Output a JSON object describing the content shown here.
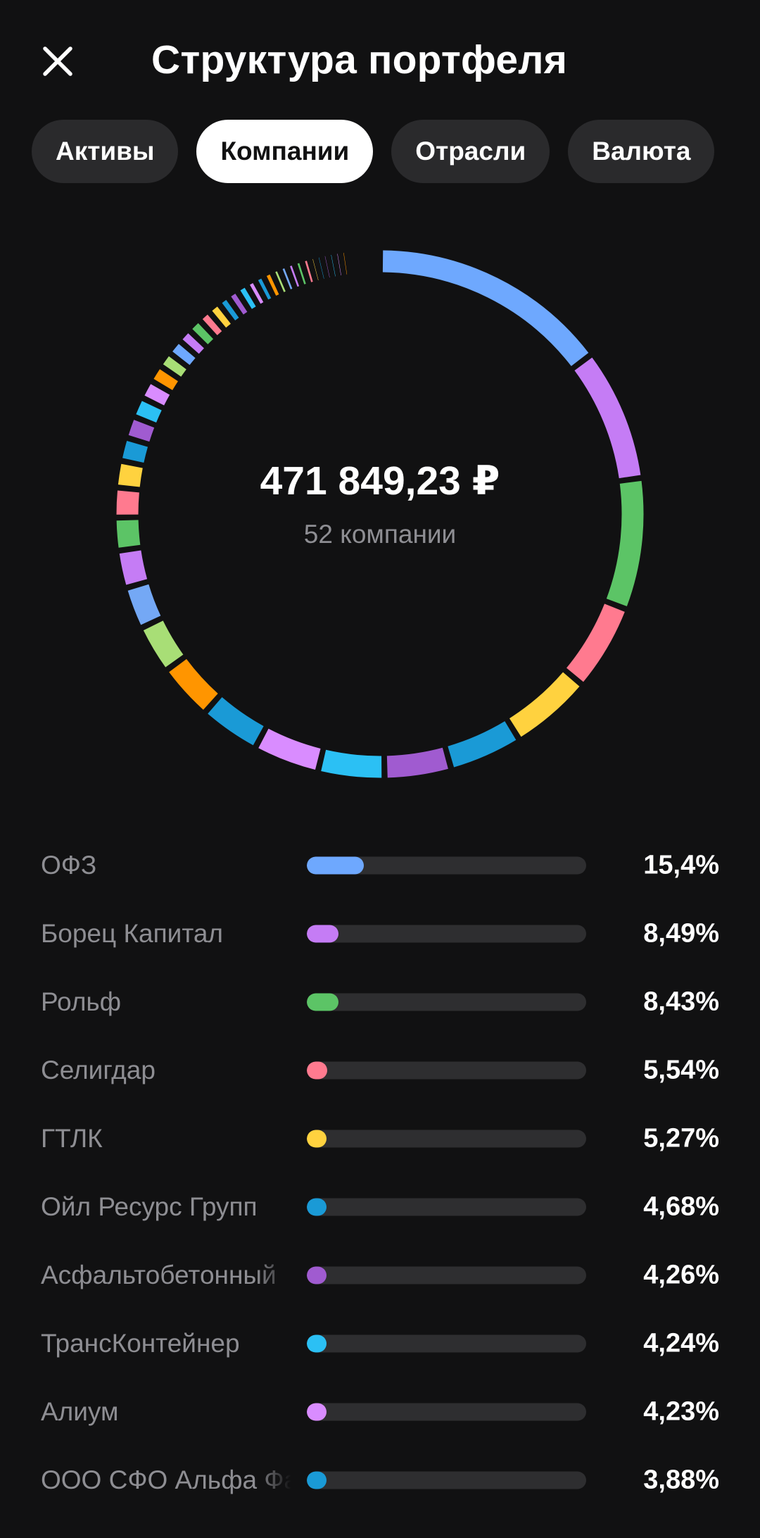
{
  "header": {
    "title": "Структура портфеля",
    "close_icon": "close-icon"
  },
  "tabs": [
    {
      "label": "Активы",
      "active": false
    },
    {
      "label": "Компании",
      "active": true
    },
    {
      "label": "Отрасли",
      "active": false
    },
    {
      "label": "Валюта",
      "active": false
    }
  ],
  "summary": {
    "total": "471 849,23 ₽",
    "count": "52 компании"
  },
  "companies": [
    {
      "name": "ОФЗ",
      "percent": "15,4%",
      "share": 15.4,
      "color": "#6ea8fe"
    },
    {
      "name": "Борец Капитал",
      "percent": "8,49%",
      "share": 8.49,
      "color": "#c57cf5"
    },
    {
      "name": "Рольф",
      "percent": "8,43%",
      "share": 8.43,
      "color": "#5cc466"
    },
    {
      "name": "Селигдар",
      "percent": "5,54%",
      "share": 5.54,
      "color": "#ff7a8f"
    },
    {
      "name": "ГТЛК",
      "percent": "5,27%",
      "share": 5.27,
      "color": "#ffd23f"
    },
    {
      "name": "Ойл Ресурс Групп",
      "percent": "4,68%",
      "share": 4.68,
      "color": "#1a9ad6"
    },
    {
      "name": "Асфальтобетонный",
      "percent": "4,26%",
      "share": 4.26,
      "color": "#a05bd0"
    },
    {
      "name": "ТрансКонтейнер",
      "percent": "4,24%",
      "share": 4.24,
      "color": "#2bc0f4"
    },
    {
      "name": "Алиум",
      "percent": "4,23%",
      "share": 4.23,
      "color": "#d98cff"
    },
    {
      "name": "ООО СФО Альфа Фа",
      "percent": "3,88%",
      "share": 3.88,
      "color": "#1a9ad6"
    }
  ],
  "chart_data": {
    "type": "pie",
    "style": "donut",
    "segment_count": 52,
    "labels": [
      "ОФЗ",
      "Борец Капитал",
      "Рольф",
      "Селигдар",
      "ГТЛК",
      "Ойл Ресурс Групп",
      "Асфальтобетонный",
      "ТрансКонтейнер",
      "Алиум",
      "ООО СФО Альфа Фа"
    ],
    "values": [
      15.4,
      8.49,
      8.43,
      5.54,
      5.27,
      4.68,
      4.26,
      4.24,
      4.23,
      3.88
    ],
    "remaining_values": [
      3.6,
      3.1,
      2.7,
      2.4,
      2.1,
      1.9,
      1.7,
      1.5,
      1.4,
      1.3,
      1.2,
      1.1,
      1.0,
      1.0,
      0.9,
      0.9,
      0.8,
      0.8,
      0.7,
      0.7,
      0.7,
      0.6,
      0.6,
      0.6,
      0.5,
      0.5,
      0.5,
      0.5,
      0.5,
      0.4,
      0.4,
      0.4,
      0.4,
      0.4,
      0.4,
      0.3,
      0.3,
      0.3,
      0.3,
      0.3,
      0.3,
      0.3
    ],
    "palette": [
      "#6ea8fe",
      "#c57cf5",
      "#5cc466",
      "#ff7a8f",
      "#ffd23f",
      "#1a9ad6",
      "#a05bd0",
      "#2bc0f4",
      "#d98cff",
      "#1a9ad6",
      "#ff9500",
      "#a8de76",
      "#74a8f5",
      "#c57cf5",
      "#5cc466",
      "#ff7a8f",
      "#ffd23f",
      "#1a9ad6",
      "#a05bd0",
      "#2bc0f4",
      "#d98cff",
      "#ff9500",
      "#a8de76"
    ]
  }
}
